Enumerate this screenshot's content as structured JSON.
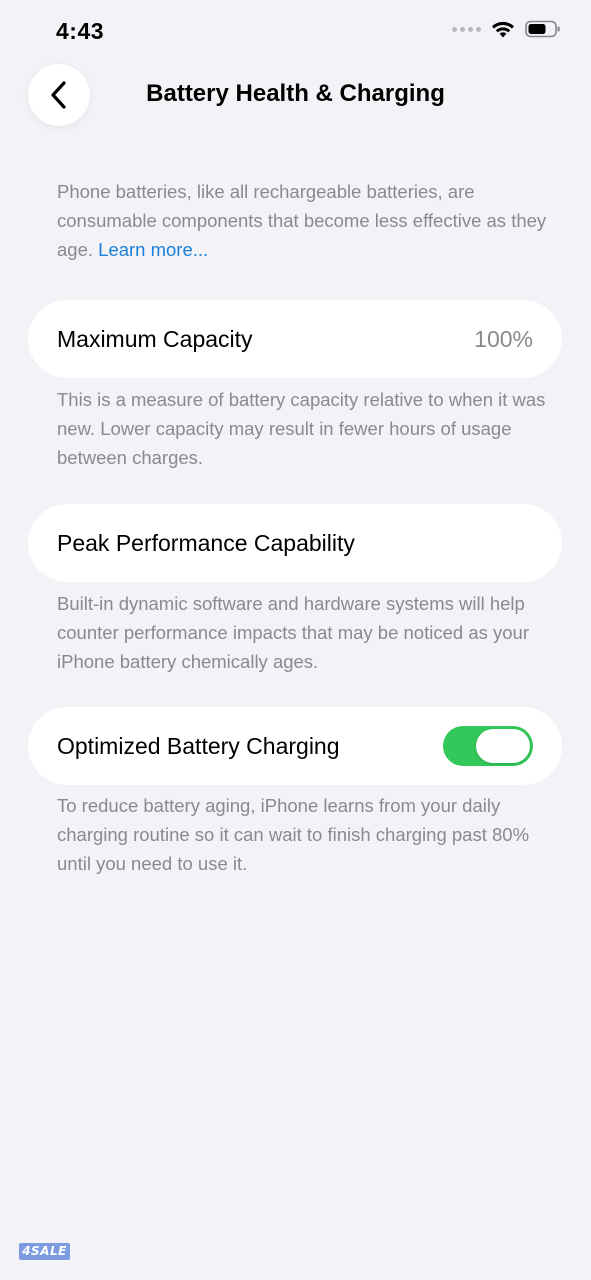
{
  "status_bar": {
    "time": "4:43",
    "icons": [
      "signal-dots-icon",
      "wifi-icon",
      "battery-icon"
    ]
  },
  "nav": {
    "back_icon": "chevron-left-icon",
    "title": "Battery Health & Charging"
  },
  "intro": {
    "text": "Phone batteries, like all rechargeable batteries, are consumable components that become less effective as they age. ",
    "link": "Learn more..."
  },
  "maximum_capacity": {
    "label": "Maximum Capacity",
    "value": "100%",
    "footnote": "This is a measure of battery capacity relative to when it was new. Lower capacity may result in fewer hours of usage between charges."
  },
  "peak_performance": {
    "label": "Peak Performance Capability",
    "footnote": "Built-in dynamic software and hardware systems will help counter performance impacts that may be noticed as your iPhone battery chemically ages."
  },
  "optimized_charging": {
    "label": "Optimized Battery Charging",
    "enabled": true,
    "footnote": "To reduce battery aging, iPhone learns from your daily charging routine so it can wait to finish charging past 80% until you need to use it."
  },
  "watermark": "4SALE",
  "colors": {
    "background": "#f2f2f7",
    "toggle_on": "#34c759",
    "link": "#1a7fd6",
    "secondary_text": "#8a8a8e"
  }
}
